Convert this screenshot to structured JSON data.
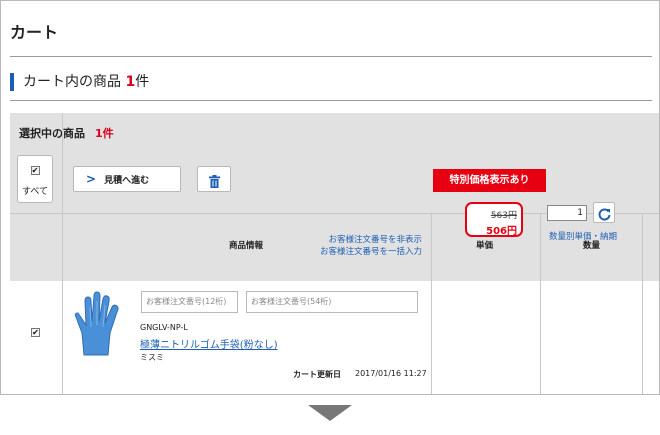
{
  "page": {
    "title": "カート"
  },
  "section": {
    "heading_prefix": "カート内の商品",
    "count": "1",
    "count_unit": "件"
  },
  "selection": {
    "label": "選択中の商品",
    "count": "1件",
    "select_all_label": "すべて",
    "quote_button": "見積へ進む"
  },
  "table": {
    "col_product": "商品情報",
    "col_unit_price": "単価",
    "col_quantity": "数量",
    "link_hide_order_no": "お客様注文番号を非表示",
    "link_bulk_order_no": "お客様注文番号を一括入力"
  },
  "item": {
    "order_no_placeholder_12": "お客様注文番号(12桁)",
    "order_no_placeholder_54": "お客様注文番号(54桁)",
    "code": "GNGLV-NP-L",
    "name": "極薄ニトリルゴム手袋(粉なし)",
    "maker": "ミスミ",
    "updated_label": "カート更新日",
    "updated_value": "2017/01/16 11:27",
    "special_price_badge": "特別価格表示あり",
    "old_price": "563円",
    "new_price": "506円",
    "quantity": "1",
    "volume_price_link": "数量別単価・納期"
  },
  "colors": {
    "accent_blue": "#1e5fb4",
    "badge_red": "#e60012",
    "count_red": "#d9001b"
  },
  "icons": [
    "chevron-right-icon",
    "trash-icon",
    "refresh-icon",
    "glove-image",
    "down-arrow-icon"
  ]
}
